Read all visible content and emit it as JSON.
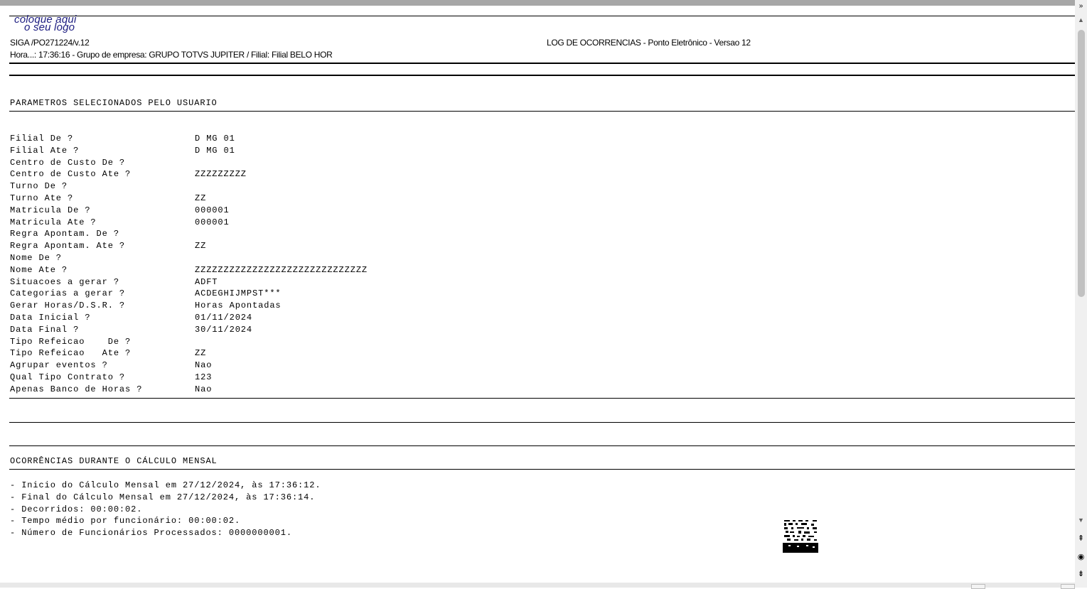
{
  "header": {
    "logo_line1": "coloque aqui",
    "logo_line2": "o seu logo",
    "program": "SIGA /PO271224/v.12",
    "report_title": "LOG DE OCORRENCIAS - Ponto Eletrônico - Versao 12",
    "time_line": "Hora...: 17:36:16 - Grupo de empresa: GRUPO TOTVS JUPITER / Filial: Filial BELO HOR"
  },
  "params_section": {
    "title": "PARAMETROS SELECIONADOS PELO USUARIO",
    "rows": [
      {
        "label": "Filial De ?",
        "value": "D MG 01"
      },
      {
        "label": "Filial Ate ?",
        "value": "D MG 01"
      },
      {
        "label": "Centro de Custo De ?",
        "value": ""
      },
      {
        "label": "Centro de Custo Ate ?",
        "value": "ZZZZZZZZZ"
      },
      {
        "label": "Turno De ?",
        "value": ""
      },
      {
        "label": "Turno Ate ?",
        "value": "ZZ"
      },
      {
        "label": "Matricula De ?",
        "value": "000001"
      },
      {
        "label": "Matricula Ate ?",
        "value": "000001"
      },
      {
        "label": "Regra Apontam. De ?",
        "value": ""
      },
      {
        "label": "Regra Apontam. Ate ?",
        "value": "ZZ"
      },
      {
        "label": "Nome De ?",
        "value": ""
      },
      {
        "label": "Nome Ate ?",
        "value": "ZZZZZZZZZZZZZZZZZZZZZZZZZZZZZZ"
      },
      {
        "label": "Situacoes a gerar ?",
        "value": "ADFT"
      },
      {
        "label": "Categorias a gerar ?",
        "value": "ACDEGHIJMPST***"
      },
      {
        "label": "Gerar Horas/D.S.R. ?",
        "value": "Horas Apontadas"
      },
      {
        "label": "Data Inicial ?",
        "value": "01/11/2024"
      },
      {
        "label": "Data Final ?",
        "value": "30/11/2024"
      },
      {
        "label": "Tipo Refeicao    De ?",
        "value": ""
      },
      {
        "label": "Tipo Refeicao   Ate ?",
        "value": "ZZ"
      },
      {
        "label": "Agrupar eventos ?",
        "value": "Nao"
      },
      {
        "label": "Qual Tipo Contrato ?",
        "value": "123"
      },
      {
        "label": "Apenas Banco de Horas ?",
        "value": "Nao"
      }
    ]
  },
  "occurrences_section": {
    "title": "OCORRÊNCIAS DURANTE O CÁLCULO MENSAL",
    "lines": [
      "- Inicio do Cálculo Mensal em 27/12/2024, às 17:36:12.",
      "- Final do Cálculo Mensal em 27/12/2024, às 17:36:14.",
      "- Decorridos: 00:00:02.",
      "- Tempo médio por funcionário: 00:00:02.",
      "- Número de Funcionários Processados: 0000000001."
    ]
  },
  "icons": {
    "scroll_up": "chevron-up-icon",
    "scroll_down": "chevron-down-icon",
    "page_top": "page-top-icon",
    "page_bottom": "page-bottom-icon",
    "zoom": "zoom-icon",
    "expand": "expand-icon",
    "qr": "qr-code-icon"
  }
}
